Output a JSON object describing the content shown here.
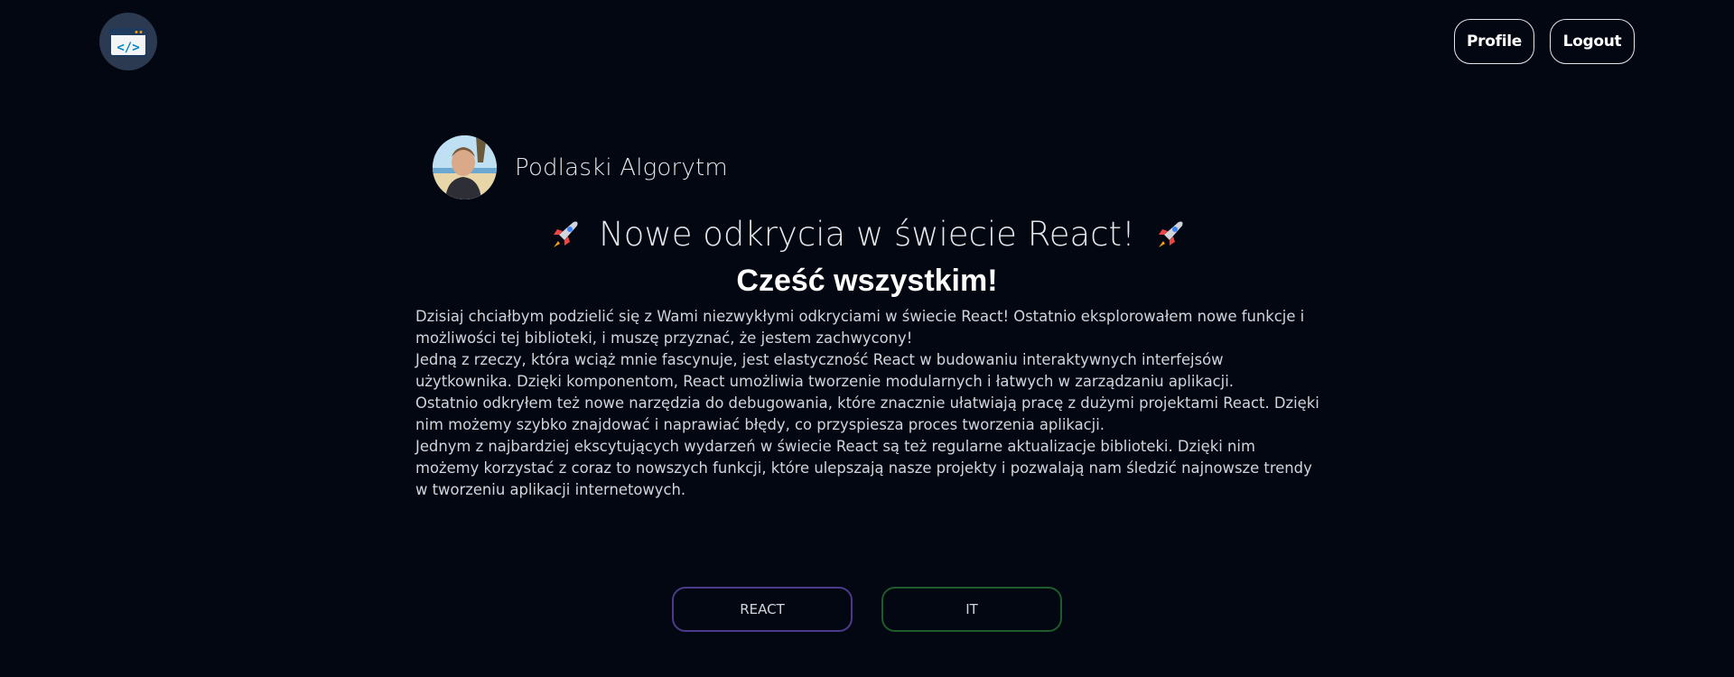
{
  "header": {
    "logo_icon": "code-window-icon",
    "profile_label": "Profile",
    "logout_label": "Logout"
  },
  "post": {
    "author": "Podlaski Algorytm",
    "title": "Nowe odkrycia w świecie React!",
    "title_icon": "rocket-icon",
    "greeting": "Cześć wszystkim!",
    "paragraphs": [
      "Dzisiaj chciałbym podzielić się z Wami niezwykłymi odkryciami w świecie React! Ostatnio eksplorowałem nowe funkcje i możliwości tej biblioteki, i muszę przyznać, że jestem zachwycony!",
      "Jedną z rzeczy, która wciąż mnie fascynuje, jest elastyczność React w budowaniu interaktywnych interfejsów użytkownika. Dzięki komponentom, React umożliwia tworzenie modularnych i łatwych w zarządzaniu aplikacji.",
      "Ostatnio odkryłem też nowe narzędzia do debugowania, które znacznie ułatwiają pracę z dużymi projektami React. Dzięki nim możemy szybko znajdować i naprawiać błędy, co przyspiesza proces tworzenia aplikacji.",
      "Jednym z najbardziej ekscytujących wydarzeń w świecie React są też regularne aktualizacje biblioteki. Dzięki nim możemy korzystać z coraz to nowszych funkcji, które ulepszają nasze projekty i pozwalają nam śledzić najnowsze trendy w tworzeniu aplikacji internetowych."
    ],
    "tags": [
      {
        "label": "REACT",
        "color": "#4c3a8a"
      },
      {
        "label": "IT",
        "color": "#1f5a2a"
      }
    ]
  },
  "colors": {
    "background": "#030712",
    "text": "#e5e7eb"
  }
}
